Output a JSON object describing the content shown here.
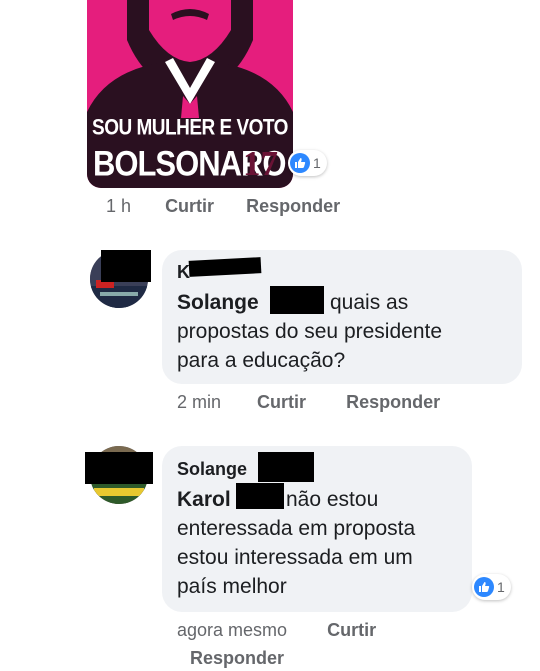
{
  "poster": {
    "line1": "SOU MULHER E VOTO",
    "line2": "BOLSONARO",
    "number": "17",
    "reaction_count": "1"
  },
  "post_meta": {
    "time": "1 h",
    "like": "Curtir",
    "reply": "Responder"
  },
  "comments": [
    {
      "author": "K",
      "mention": "Solange",
      "text_line1": "quais as",
      "text_line2": "propostas do seu presidente",
      "text_line3": "para a educação?",
      "time": "2 min",
      "like": "Curtir",
      "reply": "Responder"
    },
    {
      "author": "Solange",
      "mention": "Karol",
      "text_line1": "não estou",
      "text_line2": "enteressada em proposta",
      "text_line3": "estou interessada em um",
      "text_line4": "país melhor",
      "reaction_count": "1",
      "time": "agora mesmo",
      "like": "Curtir",
      "reply": "Responder"
    }
  ],
  "colors": {
    "poster_pink": "#e51e7d",
    "like_blue": "#2d88ff",
    "bubble_gray": "#f0f2f5",
    "meta_gray": "#65676b"
  },
  "icons": [
    "thumbs-up-icon"
  ]
}
